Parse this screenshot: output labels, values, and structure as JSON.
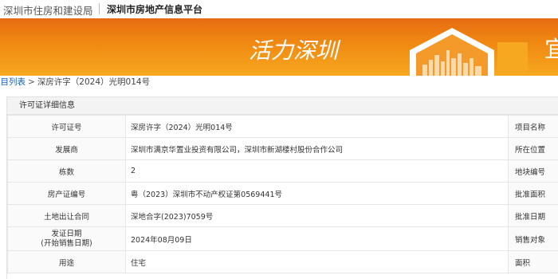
{
  "header": {
    "site_name": "深圳市住房和建设局",
    "platform_name": "深圳市房地产信息平台"
  },
  "banner": {
    "slogan": "活力深圳",
    "edge_glyph": "宜",
    "colors": {
      "top": "#e76b12",
      "bottom": "#f7a821"
    },
    "image_icon": "city-skyline-icon"
  },
  "breadcrumb": {
    "parent": "项目列表",
    "separator": ">",
    "current": "深房许字（2024）光明014号"
  },
  "panel": {
    "title": "许可证详细信息",
    "rows": [
      {
        "label": "许可证号",
        "value": "深房许字（2024）光明014号",
        "right_label": "项目名称"
      },
      {
        "label": "发展商",
        "value": "深圳市满京华置业投资有限公司，深圳市新湖楼村股份合作公司",
        "right_label": "所在位置"
      },
      {
        "label": "栋数",
        "value": "2",
        "right_label": "地块编号"
      },
      {
        "label": "房产证编号",
        "value": "粤（2023）深圳市不动产权证第0569441号",
        "right_label": "批准面积"
      },
      {
        "label": "土地出让合同",
        "value": "深地合字(2023)7059号",
        "right_label": "批准日期"
      },
      {
        "label": "发证日期",
        "label_line2": "(开始销售日期)",
        "value": "2024年08月09日",
        "right_label": "销售对象"
      },
      {
        "label": "用途",
        "value": "住宅",
        "right_label": "面积"
      }
    ]
  }
}
